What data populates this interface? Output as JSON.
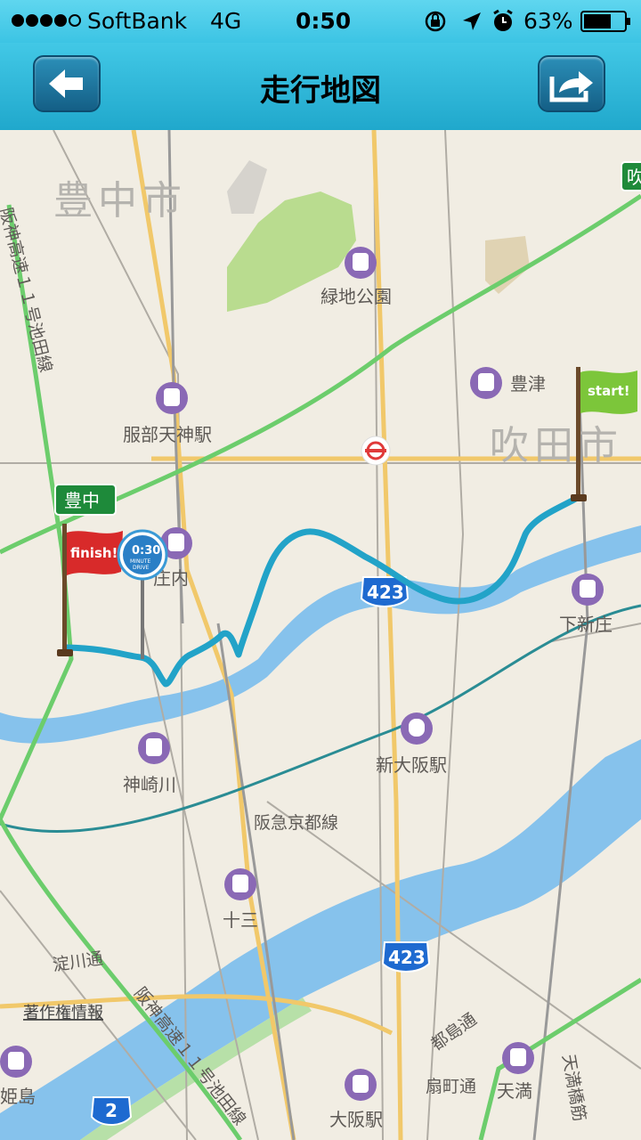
{
  "status": {
    "carrier": "SoftBank",
    "network": "4G",
    "time": "0:50",
    "battery": "63%",
    "battery_level": 0.63,
    "signal_dots_filled": 4
  },
  "nav": {
    "title": "走行地図",
    "back_icon": "arrow-left-icon",
    "share_icon": "share-arrow-icon"
  },
  "map": {
    "cities": {
      "toyonaka": "豊中市",
      "suita": "吹田市"
    },
    "stations": {
      "ryokuchi": "緑地公園",
      "toyotsu": "豊津",
      "hattori": "服部天神駅",
      "shonai": "庄内",
      "shimoshinjo": "下新庄",
      "shinosaka": "新大阪駅",
      "kanzakigawa": "神崎川",
      "juso": "十三",
      "tenma": "天満",
      "osaka": "大阪駅",
      "himejima": "姫島"
    },
    "roads": {
      "hankyu_kyoto": "阪急京都線",
      "yodogawa_dori": "淀川通",
      "hanshin_ike": "阪神高速１１号池田線",
      "hanshin_ike_north": "阪神高速１１号池田線",
      "miyakojima": "都島通",
      "ogimachi": "扇町通",
      "tenjinbashi": "天満橋筋",
      "route423_a": "423",
      "route423_b": "423",
      "route2": "2",
      "toyonaka_sign": "豊中",
      "suita_sign": "吹"
    },
    "copyright": "著作権情報",
    "start_flag": "start!",
    "finish_flag": "finish!",
    "drive_badge_time": "0:30",
    "drive_badge_line1": "MINUTE",
    "drive_badge_line2": "DRIVE"
  },
  "colors": {
    "nav_bar": "#2cb3d8",
    "route": "#22a3c8",
    "expressway": "#6ccd6c",
    "river": "#86c2ec",
    "park": "#b9dc8f",
    "station_icon": "#8a69b5"
  }
}
